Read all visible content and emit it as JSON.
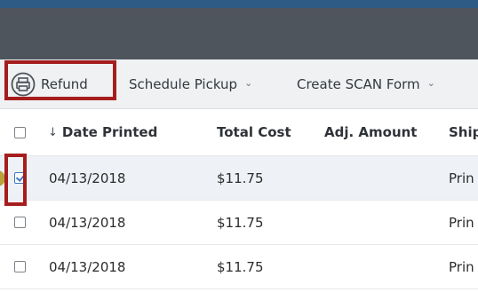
{
  "toolbar": {
    "refund_label": "Refund",
    "schedule_pickup_label": "Schedule Pickup",
    "create_scan_form_label": "Create SCAN Form"
  },
  "table": {
    "columns": [
      "Date Printed",
      "Total Cost",
      "Adj. Amount",
      "Ship"
    ],
    "rows": [
      {
        "date": "04/13/2018",
        "cost": "$11.75",
        "ship": "Prin",
        "checked": true
      },
      {
        "date": "04/13/2018",
        "cost": "$11.75",
        "ship": "Prin",
        "checked": false
      },
      {
        "date": "04/13/2018",
        "cost": "$11.75",
        "ship": "Prin",
        "checked": false
      }
    ]
  },
  "colors": {
    "highlight": "#a51d1d",
    "top_bar": "#4e555c",
    "accent_bar": "#2e5a86",
    "selected_row": "#eef2f7",
    "checkbox_checked": "#3c78c3"
  },
  "icons": {
    "refund": "printer-circle-icon",
    "dropdown": "chevron-down-icon",
    "sort": "sort-down-arrow-icon"
  }
}
